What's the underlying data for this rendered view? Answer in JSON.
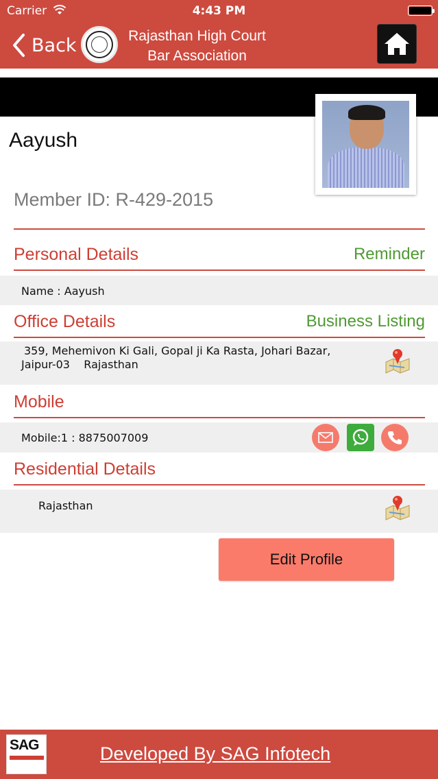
{
  "status": {
    "carrier": "Carrier",
    "time": "4:43 PM"
  },
  "nav": {
    "back_label": "Back",
    "title_line1": "Rajasthan High Court",
    "title_line2": "Bar Association",
    "logo_icon": "court-seal-logo",
    "home_icon": "home-icon"
  },
  "profile": {
    "name": "Aayush",
    "member_id": "Member ID: R-429-2015"
  },
  "personal": {
    "title": "Personal Details",
    "action": "Reminder",
    "name_line": "Name : Aayush"
  },
  "office": {
    "title": "Office Details",
    "action": "Business Listing",
    "address_line1": "359, Mehemivon Ki Gali, Gopal ji Ka Rasta, Johari Bazar,",
    "address_line2": "Jaipur-03    Rajasthan"
  },
  "mobile": {
    "title": "Mobile",
    "line": "Mobile:1 : 8875007009"
  },
  "residential": {
    "title": "Residential Details",
    "line": "Rajasthan"
  },
  "edit_label": "Edit Profile",
  "footer": {
    "developer_link": "Developed By SAG Infotech"
  },
  "colors": {
    "brand_red": "#cd4a3f",
    "link_green": "#4f9a33",
    "button_salmon": "#fb7b6b",
    "whatsapp_green": "#3eab3d"
  }
}
